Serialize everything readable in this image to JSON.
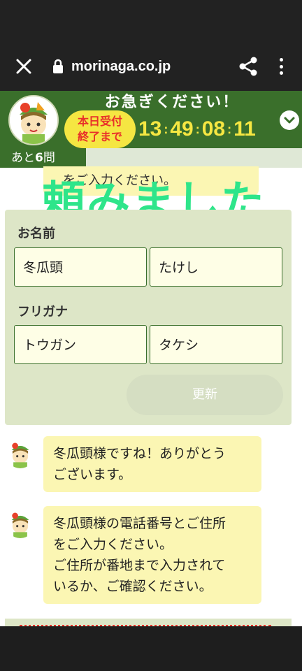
{
  "browser": {
    "url": "morinaga.co.jp",
    "close_icon": "close-icon",
    "lock_icon": "lock-icon",
    "share_icon": "share-icon",
    "menu_icon": "more-vert-icon"
  },
  "banner": {
    "title": "お急ぎください！",
    "deadline_line1": "本日受付",
    "deadline_line2": "終了まで",
    "timer": {
      "h": "13",
      "m": "49",
      "s": "08",
      "f": "11"
    },
    "colors": {
      "green": "#3a6f2b",
      "yellow": "#f5e642",
      "red": "#e8302a"
    }
  },
  "progress": {
    "prefix": "あと",
    "count": "6",
    "suffix": "問"
  },
  "previous_message_partial": "をご入力ください。",
  "overlay_text": "頼みました",
  "form": {
    "name_label": "お名前",
    "last_name": "冬瓜頭",
    "first_name": "たけし",
    "kana_label": "フリガナ",
    "last_kana": "トウガン",
    "first_kana": "タケシ",
    "update_label": "更新"
  },
  "messages": [
    {
      "lines": [
        "冬瓜頭様ですね！ありがとう",
        "ございます。"
      ]
    },
    {
      "lines": [
        "冬瓜頭様の電話番号とご住所",
        "をご入力ください。",
        "ご住所が番地まで入力されて",
        "いるか、ご確認ください。"
      ]
    }
  ]
}
